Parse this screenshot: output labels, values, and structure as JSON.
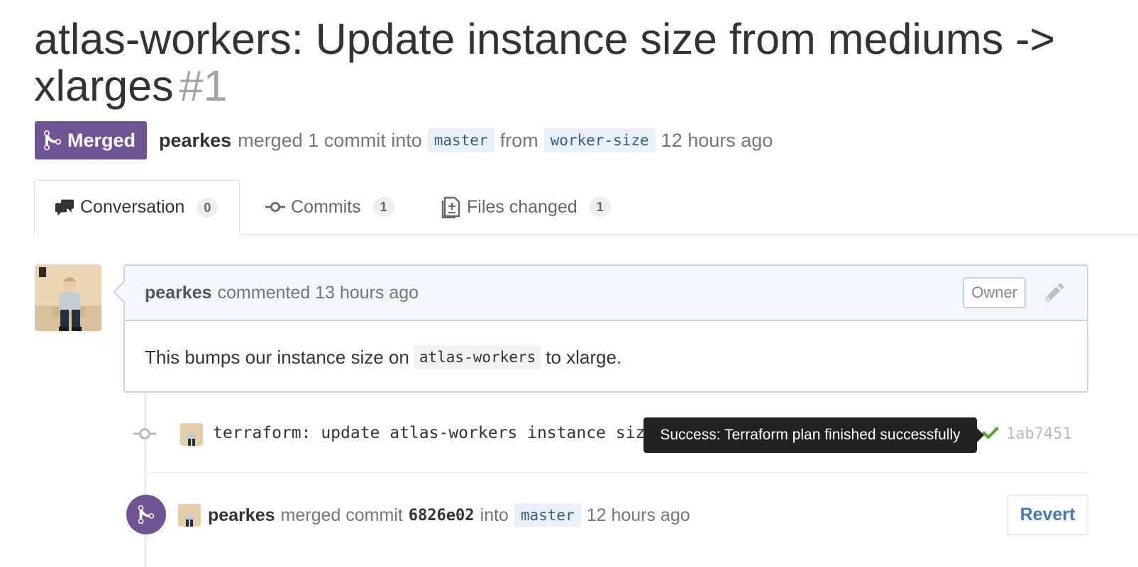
{
  "pr": {
    "title": "atlas-workers: Update instance size from mediums -> xlarges",
    "number": "#1"
  },
  "meta": {
    "state_label": "Merged",
    "author": "pearkes",
    "action": "merged 1 commit into",
    "base_branch": "master",
    "from_word": "from",
    "head_branch": "worker-size",
    "time": "12 hours ago"
  },
  "tabs": [
    {
      "label": "Conversation",
      "count": "0",
      "icon": "comment-discussion-icon"
    },
    {
      "label": "Commits",
      "count": "1",
      "icon": "git-commit-icon"
    },
    {
      "label": "Files changed",
      "count": "1",
      "icon": "file-diff-icon"
    }
  ],
  "comment": {
    "author": "pearkes",
    "action": "commented 13 hours ago",
    "role_label": "Owner",
    "body_before": "This bumps our instance size on",
    "body_code": "atlas-workers",
    "body_after": "to xlarge."
  },
  "commit": {
    "message": "terraform: update atlas-workers instance size to xlarge",
    "status": "Success: Terraform plan finished successfully",
    "sha": "1ab7451"
  },
  "merge_event": {
    "author": "pearkes",
    "action": "merged commit",
    "sha": "6826e02",
    "into_word": "into",
    "branch": "master",
    "time": "12 hours ago",
    "revert_label": "Revert"
  },
  "colors": {
    "merged_purple": "#6e5494",
    "link_blue": "#4078c0",
    "success_green": "#55a532"
  }
}
